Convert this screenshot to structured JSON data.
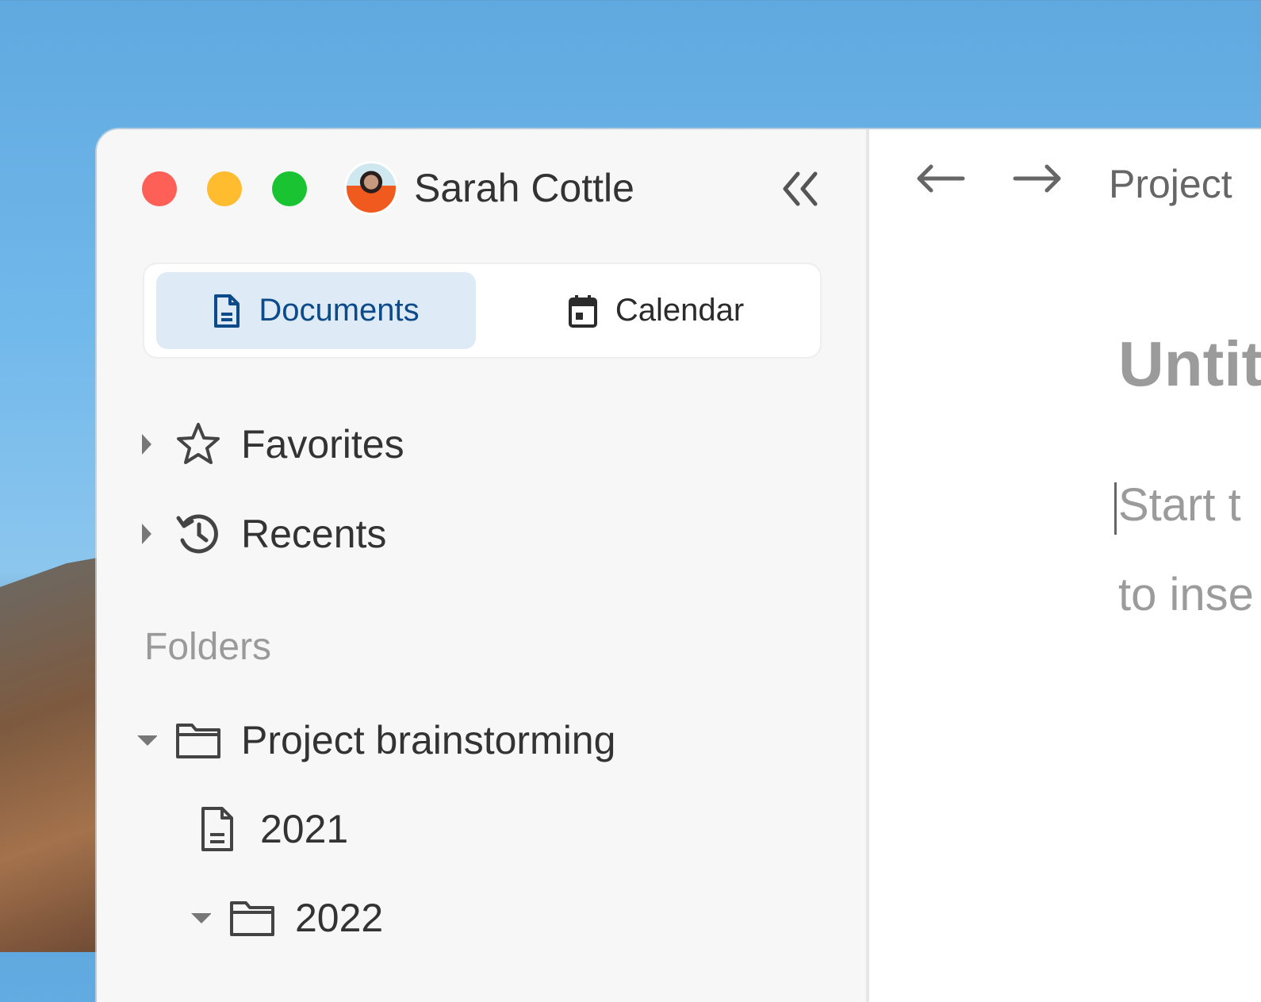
{
  "window": {
    "user_name": "Sarah Cottle",
    "colors": {
      "close": "#fe5f57",
      "minimize": "#febc2e",
      "maximize": "#19c332",
      "accent": "#0c4a8a",
      "active_tab_bg": "#deebf7"
    }
  },
  "sidebar": {
    "tabs": [
      {
        "label": "Documents",
        "icon": "document-icon",
        "active": true
      },
      {
        "label": "Calendar",
        "icon": "calendar-icon",
        "active": false
      }
    ],
    "sections": [
      {
        "label": "Favorites",
        "icon": "star-icon",
        "expanded": false
      },
      {
        "label": "Recents",
        "icon": "history-icon",
        "expanded": false
      }
    ],
    "folders_heading": "Folders",
    "tree": [
      {
        "label": "Project brainstorming",
        "type": "folder",
        "expanded": true
      },
      {
        "label": "2021",
        "type": "document"
      },
      {
        "label": "2022",
        "type": "folder",
        "expanded": true
      }
    ]
  },
  "main": {
    "breadcrumb": "Project",
    "title": "Untit",
    "placeholder_line1": "Start t",
    "placeholder_line2": "to inse"
  }
}
